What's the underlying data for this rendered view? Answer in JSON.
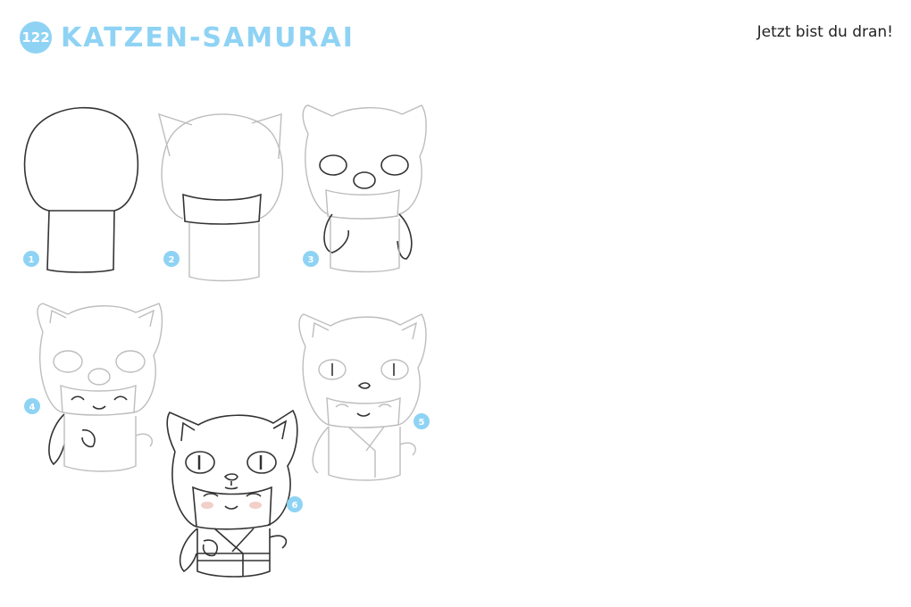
{
  "header": {
    "page_number": "122",
    "title": "KATZEN-SAMURAI"
  },
  "prompt": "Jetzt bist du dran!",
  "steps": [
    "1",
    "2",
    "3",
    "4",
    "5",
    "6"
  ],
  "colors": {
    "accent": "#8fd3f4",
    "ink": "#333333",
    "faint_line": "#bdbdbd"
  }
}
